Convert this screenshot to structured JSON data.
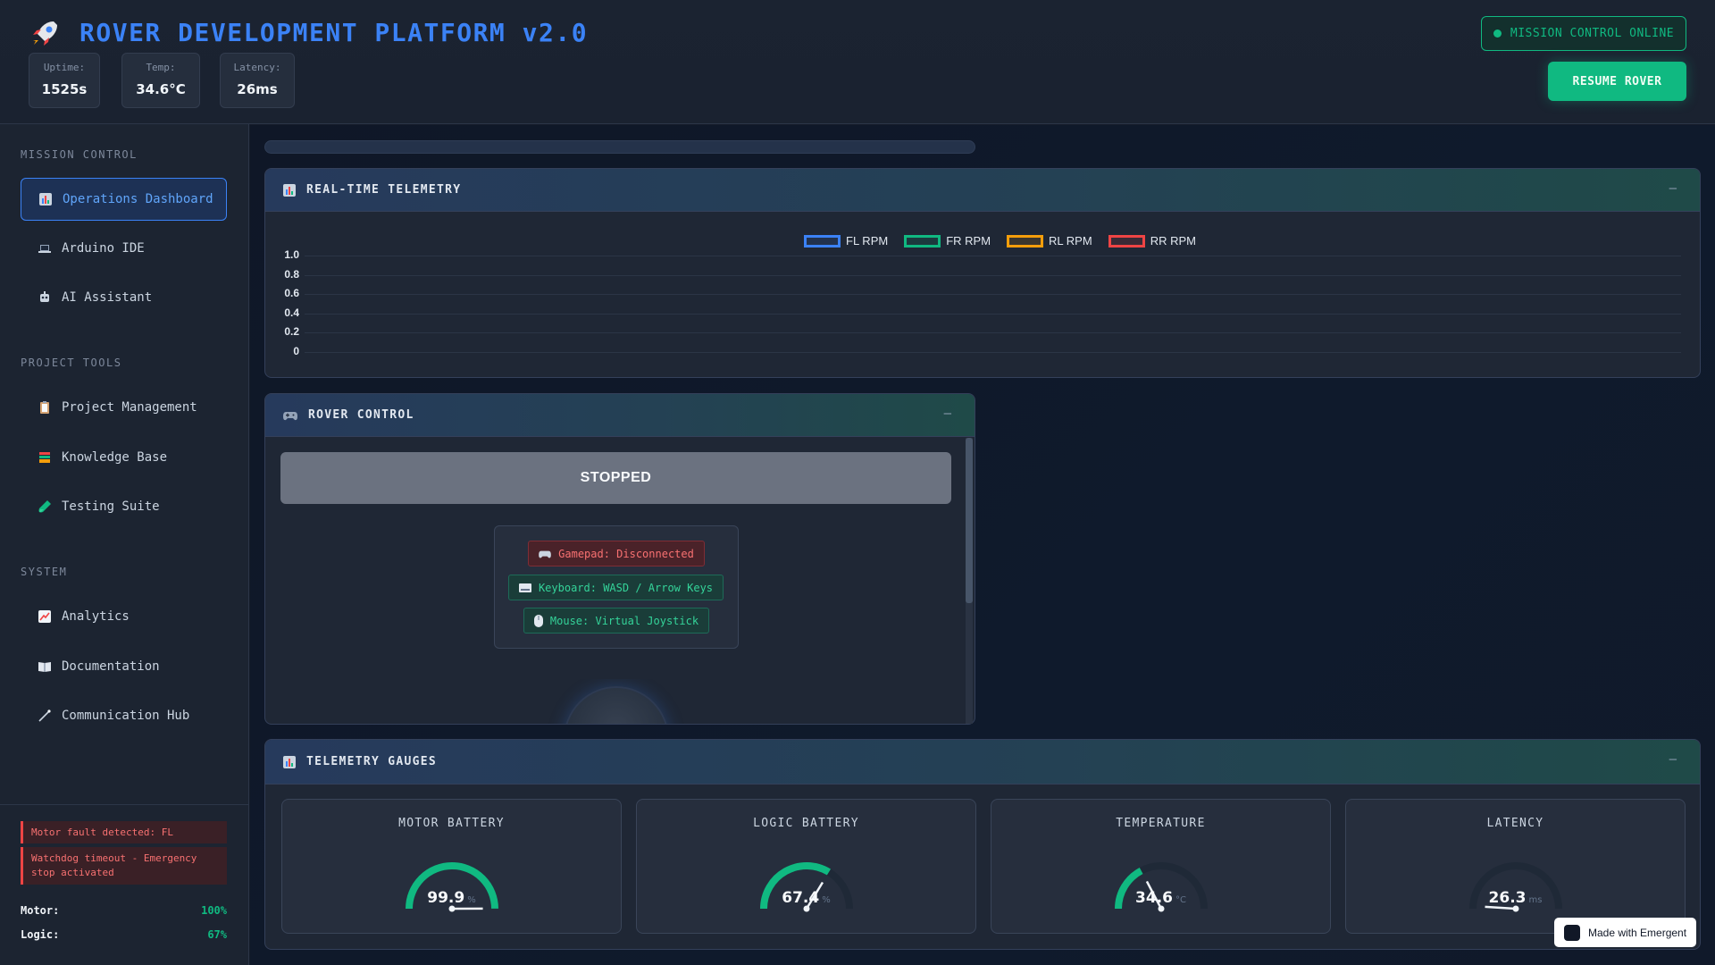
{
  "header": {
    "title": "ROVER DEVELOPMENT PLATFORM v2.0",
    "logo_icon": "rocket-icon",
    "stats": [
      {
        "label": "Uptime:",
        "value": "1525s"
      },
      {
        "label": "Temp:",
        "value": "34.6°C"
      },
      {
        "label": "Latency:",
        "value": "26ms"
      }
    ],
    "mission_status": "MISSION CONTROL ONLINE",
    "resume_label": "RESUME ROVER"
  },
  "sidebar": {
    "sections": [
      {
        "title": "MISSION CONTROL",
        "items": [
          {
            "label": "Operations Dashboard",
            "icon": "bar-chart-icon",
            "active": true
          },
          {
            "label": "Arduino IDE",
            "icon": "laptop-icon"
          },
          {
            "label": "AI Assistant",
            "icon": "robot-icon"
          }
        ]
      },
      {
        "title": "PROJECT TOOLS",
        "items": [
          {
            "label": "Project Management",
            "icon": "clipboard-icon"
          },
          {
            "label": "Knowledge Base",
            "icon": "books-icon"
          },
          {
            "label": "Testing Suite",
            "icon": "test-tube-icon"
          }
        ]
      },
      {
        "title": "SYSTEM",
        "items": [
          {
            "label": "Analytics",
            "icon": "trend-chart-icon"
          },
          {
            "label": "Documentation",
            "icon": "book-icon"
          },
          {
            "label": "Communication Hub",
            "icon": "antenna-icon"
          }
        ]
      }
    ],
    "alerts": [
      "Motor fault detected: FL",
      "Watchdog timeout - Emergency stop activated"
    ],
    "battery": [
      {
        "label": "Motor:",
        "value": "100%"
      },
      {
        "label": "Logic:",
        "value": "67%"
      }
    ]
  },
  "telemetry_panel": {
    "title": "REAL-TIME TELEMETRY",
    "minimize": "–"
  },
  "chart_data": {
    "type": "line",
    "title": "",
    "xlabel": "",
    "ylabel": "",
    "categories": [],
    "ylim": [
      0,
      1.0
    ],
    "yticks": [
      "1.0",
      "0.8",
      "0.6",
      "0.4",
      "0.2",
      "0"
    ],
    "series": [
      {
        "name": "FL RPM",
        "color": "#3b82f6",
        "values": []
      },
      {
        "name": "FR RPM",
        "color": "#10b981",
        "values": []
      },
      {
        "name": "RL RPM",
        "color": "#f59e0b",
        "values": []
      },
      {
        "name": "RR RPM",
        "color": "#ef4444",
        "values": []
      }
    ],
    "grid": true,
    "legend": "top-center"
  },
  "rover_panel": {
    "title": "ROVER CONTROL",
    "minimize": "–",
    "state": "STOPPED",
    "inputs": [
      {
        "label": "Gamepad: Disconnected",
        "icon": "gamepad-icon",
        "status": "error"
      },
      {
        "label": "Keyboard: WASD / Arrow Keys",
        "icon": "keyboard-icon",
        "status": "ok"
      },
      {
        "label": "Mouse: Virtual Joystick",
        "icon": "mouse-icon",
        "status": "ok"
      }
    ]
  },
  "gauges_panel": {
    "title": "TELEMETRY GAUGES",
    "minimize": "–",
    "gauges": [
      {
        "title": "MOTOR BATTERY",
        "value": "99.9",
        "unit": "%",
        "fraction": 0.999
      },
      {
        "title": "LOGIC BATTERY",
        "value": "67.4",
        "unit": "%",
        "fraction": 0.674
      },
      {
        "title": "TEMPERATURE",
        "value": "34.6",
        "unit": "°C",
        "fraction": 0.346
      },
      {
        "title": "LATENCY",
        "value": "26.3",
        "unit": "ms",
        "fraction": 0.0
      }
    ]
  },
  "footer": {
    "made_with": "Made with Emergent"
  },
  "colors": {
    "accent": "#3b82f6",
    "success": "#10b981",
    "danger": "#ef4444",
    "warning": "#f59e0b"
  }
}
